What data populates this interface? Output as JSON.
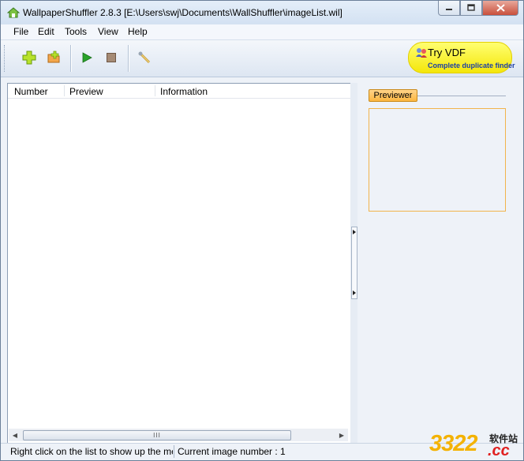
{
  "window": {
    "title": "WallpaperShuffler 2.8.3 [E:\\Users\\swj\\Documents\\WallShuffler\\imageList.wil]"
  },
  "menu": {
    "items": [
      "File",
      "Edit",
      "Tools",
      "View",
      "Help"
    ]
  },
  "toolbar": {
    "buttons": [
      "add-icon",
      "open-list-icon",
      "play-icon",
      "stop-icon",
      "settings-wand-icon"
    ],
    "promo": {
      "title": "Try VDF",
      "subtitle": "Complete duplicate finder"
    }
  },
  "list": {
    "columns": [
      "Number",
      "Preview",
      "Information"
    ],
    "rows": [],
    "scroll_grip": "III"
  },
  "previewer": {
    "tab_label": "Previewer"
  },
  "status": {
    "left": "Right click on the list to show up the menu",
    "right": "Current image number : 1"
  },
  "watermark": {
    "digits": "3322",
    "suffix": ".cc",
    "chinese": "软件站"
  },
  "colors": {
    "title_bar": "#d8e4f3",
    "close_button": "#c9503c",
    "promo_yellow": "#ffff4a",
    "previewer_tab": "#fcb640",
    "preview_border": "#f2b44c"
  }
}
